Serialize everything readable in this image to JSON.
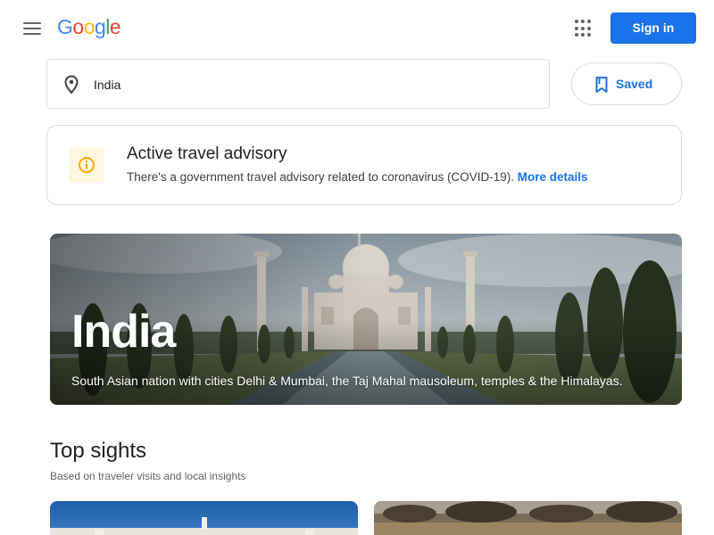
{
  "header": {
    "logo_letters": [
      {
        "ch": "G",
        "color": "#4285f4"
      },
      {
        "ch": "o",
        "color": "#ea4335"
      },
      {
        "ch": "o",
        "color": "#fbbc05"
      },
      {
        "ch": "g",
        "color": "#4285f4"
      },
      {
        "ch": "l",
        "color": "#34a853"
      },
      {
        "ch": "e",
        "color": "#ea4335"
      }
    ],
    "signin_label": "Sign in",
    "menu_icon": "hamburger-menu-icon",
    "apps_icon": "apps-grid-icon"
  },
  "search": {
    "value": "India",
    "icon": "location-pin-icon"
  },
  "saved": {
    "label": "Saved",
    "icon": "bookmark-icon"
  },
  "advisory": {
    "title": "Active travel advisory",
    "text": "There's a government travel advisory related to coronavirus (COVID-19).",
    "link": "More details",
    "icon": "info-icon",
    "accent": "#f9ab00"
  },
  "hero": {
    "title": "India",
    "description": "South Asian nation with cities Delhi & Mumbai, the Taj Mahal mausoleum, temples & the Himalayas."
  },
  "top_sights": {
    "title": "Top sights",
    "subtitle": "Based on traveler visits and local insights"
  },
  "colors": {
    "primary": "#1a73e8",
    "border": "#dadce0",
    "text": "#202124",
    "muted": "#5f6368"
  }
}
